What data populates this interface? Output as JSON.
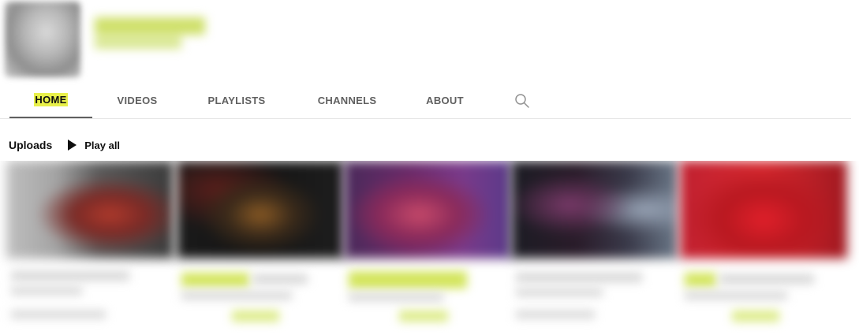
{
  "tabs": [
    {
      "label": "HOME",
      "active": true
    },
    {
      "label": "VIDEOS",
      "active": false
    },
    {
      "label": "PLAYLISTS",
      "active": false
    },
    {
      "label": "CHANNELS",
      "active": false
    },
    {
      "label": "ABOUT",
      "active": false
    }
  ],
  "tab_search_icon": "search-icon",
  "uploads": {
    "title": "Uploads",
    "play_all_label": "Play all",
    "play_all_icon": "play-icon"
  },
  "colors": {
    "highlight": "#e8f04a",
    "blur_highlight": "#d3e55c",
    "tab_underline": "#606060",
    "divider": "#e5e5e5",
    "text_primary": "#0f0f0f",
    "text_secondary": "#606060"
  }
}
